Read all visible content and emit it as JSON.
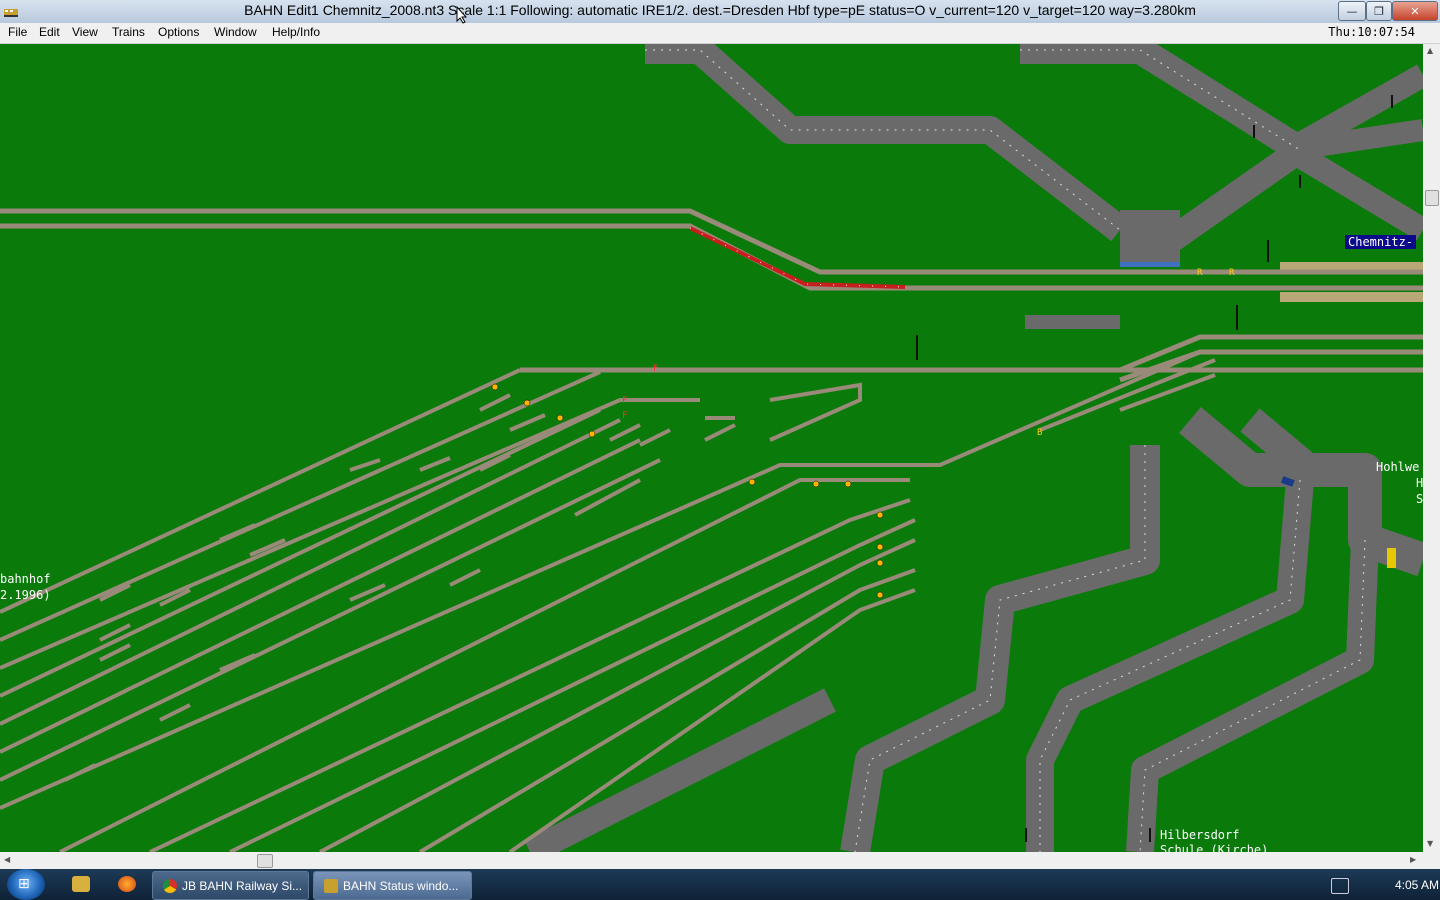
{
  "window": {
    "title": "BAHN Edit1 Chemnitz_2008.nt3 Scale 1:1 Following: automatic IRE1/2.  dest.=Dresden Hbf type=pE status=O  v_current=120 v_target=120 way=3.280km",
    "minimize_label": "—",
    "maximize_label": "❐",
    "close_label": "✕"
  },
  "menu": {
    "items": [
      "File",
      "Edit",
      "View",
      "Trains",
      "Options",
      "Window",
      "Help/Info"
    ],
    "clock": "Thu:10:07:54"
  },
  "map": {
    "labels": {
      "station_sign": "Chemnitz-",
      "left_line1": "bahnhof",
      "left_line2": "2.1996)",
      "right_line1": "Hohlwe",
      "right_line2": "H",
      "right_line3": "S",
      "bottom_line1": "Hilbersdorf",
      "bottom_line2": "Schule (Kirche)"
    },
    "colors": {
      "grass": "#0a7a0a",
      "road": "#6a6a6a",
      "track": "#9a8a7a",
      "train": "#c81e1e",
      "platform": "#b8a878"
    },
    "signal_markers": [
      "F",
      "F",
      "F",
      "B",
      "R",
      "R"
    ]
  },
  "taskbar": {
    "tasks": [
      {
        "label": "JB BAHN Railway Si..."
      },
      {
        "label": "BAHN Status windo..."
      }
    ],
    "time": "4:05 AM"
  },
  "icons": {
    "start": "windows-start-icon",
    "explorer": "folder-icon",
    "firefox": "firefox-icon",
    "chrome": "chrome-icon",
    "bahn": "bahn-app-icon",
    "tray": "network-icon"
  }
}
